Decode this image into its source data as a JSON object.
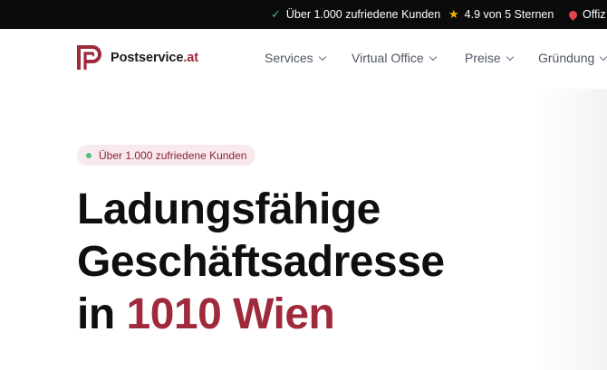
{
  "topbar": {
    "customers": "Über 1.000 zufriedene Kunden",
    "rating": "4.9 von 5 Sternen",
    "office": "Offiz"
  },
  "logo": {
    "name": "Postservice",
    "tld": ".at"
  },
  "nav": {
    "items": [
      {
        "label": "Services"
      },
      {
        "label": "Virtual Office"
      },
      {
        "label": "Preise"
      },
      {
        "label": "Gründung"
      }
    ]
  },
  "hero": {
    "badge": "Über 1.000 zufriedene Kunden",
    "headline_line1": "Ladungsfähige",
    "headline_line2": "Geschäftsadresse",
    "headline_line3_prefix": "in ",
    "headline_line3_accent": "1010 Wien"
  },
  "colors": {
    "brand": "#9e2a3b",
    "topbar_bg": "#0b0b0c",
    "check": "#39c07a",
    "star": "#f5b400",
    "pin": "#e3464b"
  },
  "icons": [
    "check-icon",
    "star-icon",
    "map-pin-icon",
    "postservice-logo-icon",
    "chevron-down-icon"
  ]
}
